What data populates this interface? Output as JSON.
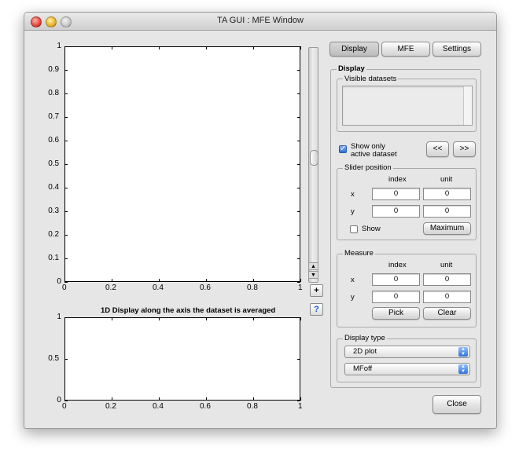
{
  "window": {
    "title": "TA GUI : MFE Window"
  },
  "tabs": [
    {
      "label": "Display",
      "active": true
    },
    {
      "label": "MFE",
      "active": false
    },
    {
      "label": "Settings",
      "active": false
    }
  ],
  "main_plot": {
    "x_ticks": [
      "0",
      "0.2",
      "0.4",
      "0.6",
      "0.8",
      "1"
    ],
    "y_ticks": [
      "0",
      "0.1",
      "0.2",
      "0.3",
      "0.4",
      "0.5",
      "0.6",
      "0.7",
      "0.8",
      "0.9",
      "1"
    ]
  },
  "bottom_plot": {
    "caption": "1D Display along the axis the dataset is averaged",
    "x_ticks": [
      "0",
      "0.2",
      "0.4",
      "0.6",
      "0.8",
      "1"
    ],
    "y_ticks": [
      "0",
      "0.5",
      "1"
    ]
  },
  "side_buttons": {
    "plus": "+",
    "help": "?"
  },
  "display_panel": {
    "title": "Display",
    "visible_datasets": {
      "title": "Visible datasets",
      "items": []
    },
    "show_only_active": {
      "label_line1": "Show only",
      "label_line2": "active dataset",
      "checked": true
    },
    "prev_button": "<<",
    "next_button": ">>",
    "slider_position": {
      "title": "Slider position",
      "col_index": "index",
      "col_unit": "unit",
      "rows": [
        {
          "label": "x",
          "index": "0",
          "unit": "0"
        },
        {
          "label": "y",
          "index": "0",
          "unit": "0"
        }
      ],
      "show_label": "Show",
      "show_checked": false,
      "maximum_button": "Maximum"
    },
    "measure": {
      "title": "Measure",
      "col_index": "index",
      "col_unit": "unit",
      "rows": [
        {
          "label": "x",
          "index": "0",
          "unit": "0"
        },
        {
          "label": "y",
          "index": "0",
          "unit": "0"
        }
      ],
      "pick_button": "Pick",
      "clear_button": "Clear"
    },
    "display_type": {
      "title": "Display type",
      "plot_type": "2D plot",
      "mode": "MFoff"
    }
  },
  "close_button": "Close"
}
